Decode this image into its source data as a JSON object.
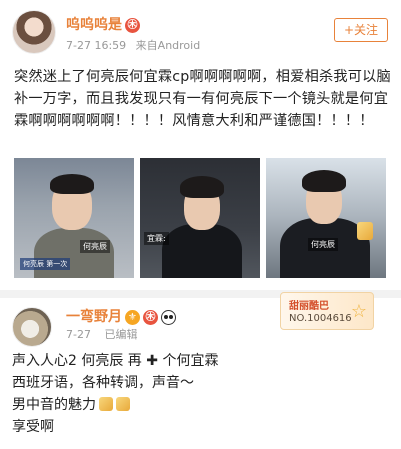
{
  "post": {
    "username": "呜呜呜是",
    "badge": "㊍",
    "time": "7-27 16:59",
    "source": "来自Android",
    "follow_label": "+关注",
    "text": "突然迷上了何亮辰何宜霖cp啊啊啊啊啊，相爱相杀我可以脑补一万字，而且我发现只有一有何亮辰下一个镜头就是何宜霖啊啊啊啊啊啊！！！！风情意大利和严谨德国！！！！",
    "photos": [
      {
        "name_tag": "何亮辰",
        "caption": "何亮辰 第一次"
      },
      {
        "name_tag": "宜霖:"
      },
      {
        "name_tag": "何亮辰"
      }
    ]
  },
  "comment": {
    "username": "一弯野月",
    "time": "7-27",
    "edited": "已编辑",
    "fan_badge": {
      "title": "甜丽酷巴",
      "number": "NO.1004616",
      "star": "☆"
    },
    "lines": [
      {
        "a": "声入人心2 何亮辰 再",
        "cross": "✚",
        "b": "个何宜霖"
      },
      {
        "text": "西班牙语，各种转调，声音～"
      },
      {
        "text": "男中音的魅力"
      },
      {
        "text": "享受啊"
      }
    ]
  }
}
